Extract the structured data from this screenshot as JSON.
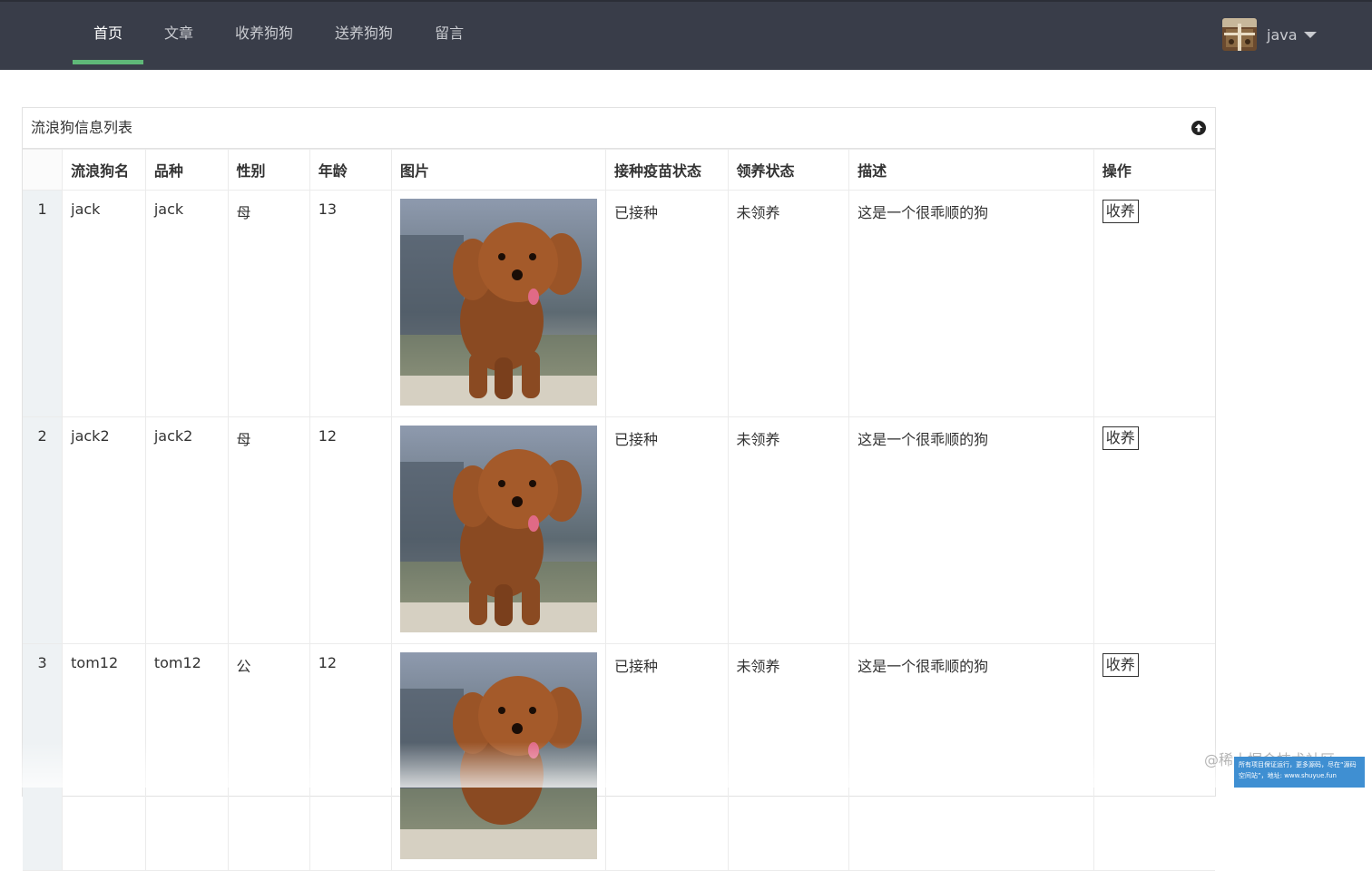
{
  "nav": {
    "items": [
      {
        "label": "首页",
        "active": true
      },
      {
        "label": "文章"
      },
      {
        "label": "收养狗狗"
      },
      {
        "label": "送养狗狗"
      },
      {
        "label": "留言"
      }
    ],
    "accent": "#5fb878",
    "background": "#393d49"
  },
  "user": {
    "name": "java",
    "avatar_icon": "avatar-image"
  },
  "panel": {
    "title": "流浪狗信息列表",
    "collapse_icon": "arrow-up-circle-icon"
  },
  "table": {
    "columns": [
      "",
      "流浪狗名",
      "品种",
      "性别",
      "年龄",
      "图片",
      "接种疫苗状态",
      "领养状态",
      "描述",
      "操作"
    ],
    "rows": [
      {
        "index": "1",
        "name": "jack",
        "breed": "jack",
        "gender": "母",
        "age": "13",
        "vaccine": "已接种",
        "adopt_status": "未领养",
        "description": "这是一个很乖顺的狗",
        "action": "收养"
      },
      {
        "index": "2",
        "name": "jack2",
        "breed": "jack2",
        "gender": "母",
        "age": "12",
        "vaccine": "已接种",
        "adopt_status": "未领养",
        "description": "这是一个很乖顺的狗",
        "action": "收养"
      },
      {
        "index": "3",
        "name": "tom12",
        "breed": "tom12",
        "gender": "公",
        "age": "12",
        "vaccine": "已接种",
        "adopt_status": "未领养",
        "description": "这是一个很乖顺的狗",
        "action": "收养"
      }
    ]
  },
  "watermark": "@稀土掘金技术社区",
  "promo": {
    "line1": "所有项目保证运行，更多源码，尽在“源码",
    "line2": "空间站”，地址: www.shuyue.fun"
  }
}
